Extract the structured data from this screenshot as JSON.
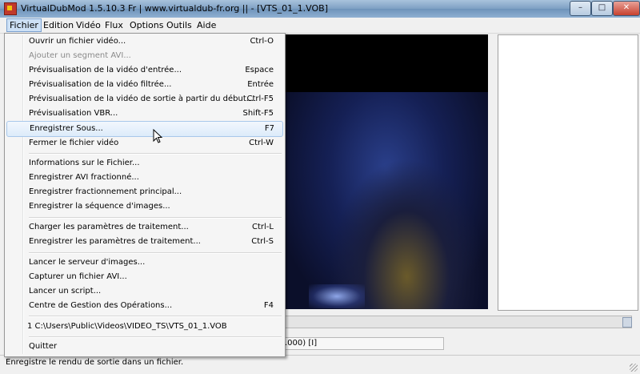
{
  "window": {
    "title": "VirtualDubMod 1.5.10.3 Fr | www.virtualdub-fr.org ||  - [VTS_01_1.VOB]"
  },
  "menubar": {
    "items": [
      "Fichier",
      "Edition",
      "Vidéo",
      "Flux",
      "Options",
      "Outils",
      "Aide"
    ],
    "active": "Fichier"
  },
  "file_menu": {
    "items": [
      {
        "label": "Ouvrir un fichier vidéo...",
        "shortcut": "Ctrl-O"
      },
      {
        "label": "Ajouter un segment AVI...",
        "shortcut": "",
        "disabled": true
      },
      {
        "label": "Prévisualisation de la vidéo d'entrée...",
        "shortcut": "Espace"
      },
      {
        "label": "Prévisualisation de la vidéo filtrée...",
        "shortcut": "Entrée"
      },
      {
        "label": "Prévisualisation de la vidéo de sortie à partir du début...",
        "shortcut": "Ctrl-F5"
      },
      {
        "label": "Prévisualisation VBR...",
        "shortcut": "Shift-F5"
      },
      {
        "label": "Enregistrer Sous...",
        "shortcut": "F7",
        "highlighted": true
      },
      {
        "label": "Fermer le fichier vidéo",
        "shortcut": "Ctrl-W"
      },
      {
        "label": "Informations sur le Fichier...",
        "shortcut": ""
      },
      {
        "label": "Enregistrer AVI fractionné...",
        "shortcut": ""
      },
      {
        "label": "Enregistrer fractionnement principal...",
        "shortcut": ""
      },
      {
        "label": "Enregistrer la séquence d'images...",
        "shortcut": ""
      },
      {
        "label": "Charger les paramètres de traitement...",
        "shortcut": "Ctrl-L"
      },
      {
        "label": "Enregistrer les paramètres de traitement...",
        "shortcut": "Ctrl-S"
      },
      {
        "label": "Lancer le serveur d'images...",
        "shortcut": ""
      },
      {
        "label": "Capturer un fichier AVI...",
        "shortcut": ""
      },
      {
        "label": "Lancer un script...",
        "shortcut": ""
      },
      {
        "label": "Centre de Gestion des Opérations...",
        "shortcut": "F4"
      },
      {
        "label": "1 C:\\Users\\Public\\Videos\\VIDEO_TS\\VTS_01_1.VOB",
        "shortcut": ""
      },
      {
        "label": "Quitter",
        "shortcut": ""
      }
    ]
  },
  "frame_info": ".000) [I]",
  "status": {
    "text": "Enregistre le rendu de sortie dans un fichier."
  },
  "icons": {
    "app": "virtualdub-app-icon",
    "minimize": "minimize-icon",
    "maximize": "maximize-icon",
    "close": "close-icon",
    "cursor": "mouse-pointer-icon"
  }
}
